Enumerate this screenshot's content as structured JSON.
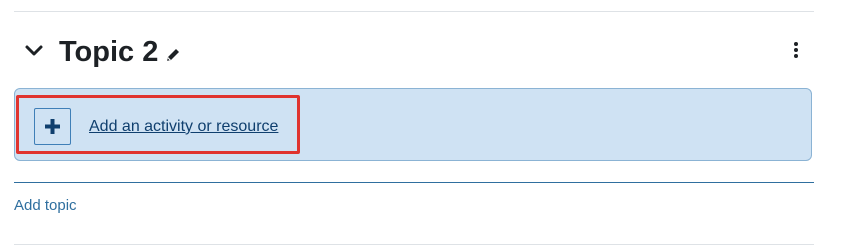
{
  "section": {
    "title": "Topic 2",
    "collapse_icon": "chevron-down-icon",
    "edit_icon": "pencil-icon",
    "menu_icon": "kebab-menu-icon"
  },
  "add_activity": {
    "label": "Add an activity or resource",
    "icon": "plus-icon",
    "highlight_color": "#e0342f",
    "background_color": "#cfe2f3"
  },
  "add_topic": {
    "label": "Add topic"
  }
}
